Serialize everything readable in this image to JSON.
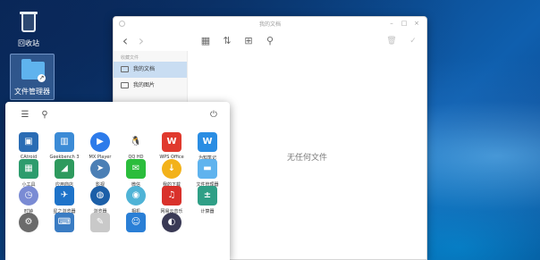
{
  "desktop": {
    "icons": [
      {
        "label": "回收站",
        "icon": "trash-icon"
      },
      {
        "label": "文件管理器",
        "icon": "folder-icon"
      }
    ]
  },
  "file_manager": {
    "title": "我的文档",
    "toolbar": {
      "back": "‹",
      "forward": "›",
      "grid_view": "▦",
      "sort": "⇅",
      "new_folder": "⊞",
      "search": "⚲",
      "trash": "🗑",
      "status": "✓"
    },
    "window_controls": {
      "minimize": "–",
      "maximize": "□",
      "close": "×"
    },
    "sidebar": {
      "section_label": "收藏文件",
      "items": [
        {
          "label": "我的文档",
          "active": true
        },
        {
          "label": "我的图片",
          "active": false
        }
      ]
    },
    "empty_message": "无任何文件"
  },
  "launcher": {
    "top": {
      "menu": "☰",
      "search": "⚲",
      "power": "⏻"
    },
    "apps": [
      {
        "label": "CAtroid",
        "icon": "catroid-icon",
        "color": "#2a6cb4",
        "glyph": "▣"
      },
      {
        "label": "Geekbench 3",
        "icon": "geekbench-icon",
        "color": "#3c8bd6",
        "glyph": "▥"
      },
      {
        "label": "MX Player",
        "icon": "mx-player-icon",
        "color": "#2d7bea",
        "glyph": "▶",
        "round": true
      },
      {
        "label": "QQ HD",
        "icon": "qq-icon",
        "color": "#ffffff",
        "glyph": "🐧",
        "round": true
      },
      {
        "label": "WPS Office",
        "icon": "wps-icon",
        "color": "#e03a2e",
        "glyph": "W"
      },
      {
        "label": "为知笔记",
        "icon": "wiz-note-icon",
        "color": "#2a8de3",
        "glyph": "W"
      },
      {
        "label": "小工具",
        "icon": "tools-icon",
        "color": "#2d9c6d",
        "glyph": "▦"
      },
      {
        "label": "应用商店",
        "icon": "app-store-icon",
        "color": "#2e9a5e",
        "glyph": "◢"
      },
      {
        "label": "影视",
        "icon": "video-icon",
        "color": "#4b7fb5",
        "glyph": "➤",
        "round": true
      },
      {
        "label": "微信",
        "icon": "wechat-icon",
        "color": "#2bbd3c",
        "glyph": "✉"
      },
      {
        "label": "我的下载",
        "icon": "download-icon",
        "color": "#f3b21a",
        "glyph": "↓",
        "round": true
      },
      {
        "label": "文件管理器",
        "icon": "file-manager-icon",
        "color": "#5fb3ee",
        "glyph": "▬"
      },
      {
        "label": "时钟",
        "icon": "clock-icon",
        "color": "#7a8bd4",
        "glyph": "◷",
        "round": true
      },
      {
        "label": "星之浏览器",
        "icon": "star-browser-icon",
        "color": "#1e73c9",
        "glyph": "✈"
      },
      {
        "label": "浏览器",
        "icon": "browser-icon",
        "color": "#1c5fa8",
        "glyph": "◍",
        "round": true
      },
      {
        "label": "相机",
        "icon": "camera-icon",
        "color": "#4fb3d6",
        "glyph": "◉",
        "round": true
      },
      {
        "label": "网易云音乐",
        "icon": "netease-music-icon",
        "color": "#d9312b",
        "glyph": "♫"
      },
      {
        "label": "计算器",
        "icon": "calculator-icon",
        "color": "#2f9f86",
        "glyph": "±"
      },
      {
        "label": "",
        "icon": "settings-icon",
        "color": "#6b6b6b",
        "glyph": "⚙",
        "round": true
      },
      {
        "label": "",
        "icon": "keyboard-icon",
        "color": "#3a7cc3",
        "glyph": "⌨"
      },
      {
        "label": "",
        "icon": "notes-icon",
        "color": "#c9c9c9",
        "glyph": "✎"
      },
      {
        "label": "",
        "icon": "contacts-icon",
        "color": "#2a7fd6",
        "glyph": "☺"
      },
      {
        "label": "",
        "icon": "music-icon",
        "color": "#3a3a55",
        "glyph": "◐",
        "round": true
      }
    ]
  }
}
